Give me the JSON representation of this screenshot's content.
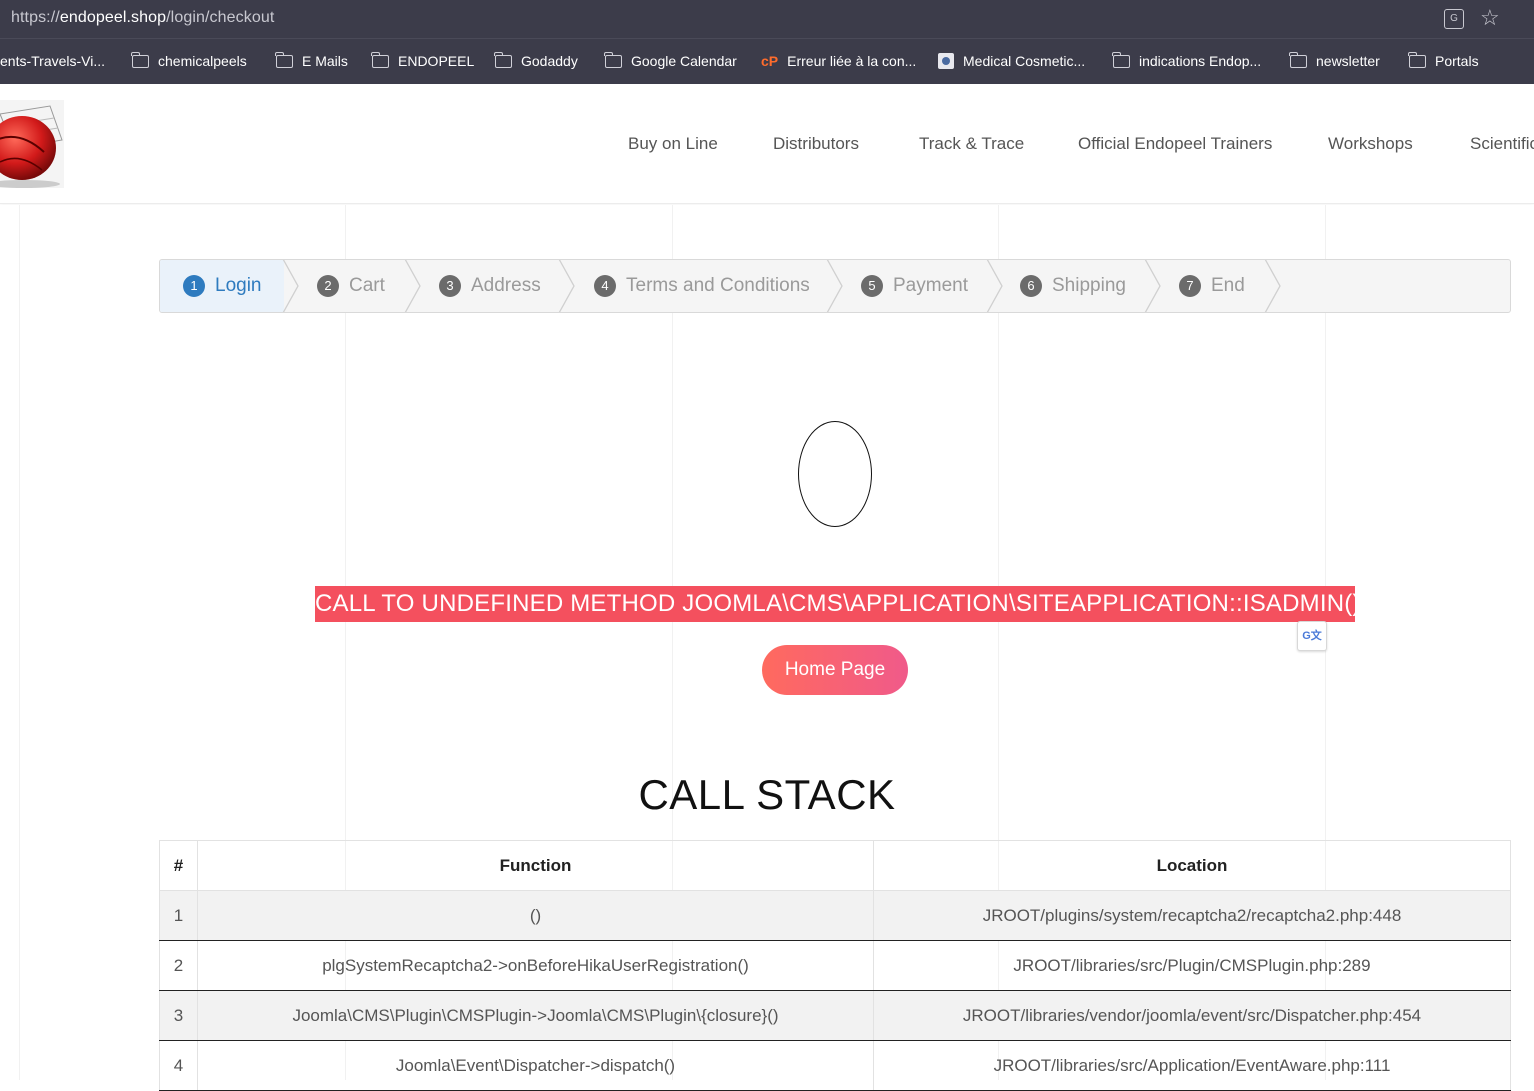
{
  "browser": {
    "url_scheme": "https://",
    "url_host": "endopeel.shop",
    "url_path": "/login/checkout",
    "bookmarks": [
      {
        "label": "ents-Travels-Vi...",
        "icon": "none"
      },
      {
        "label": "chemicalpeels",
        "icon": "folder-icon"
      },
      {
        "label": "E Mails",
        "icon": "folder-icon"
      },
      {
        "label": "ENDOPEEL",
        "icon": "folder-icon"
      },
      {
        "label": "Godaddy",
        "icon": "folder-icon"
      },
      {
        "label": "Google Calendar",
        "icon": "folder-icon"
      },
      {
        "label": "Erreur liée à la con...",
        "icon": "cpanel-icon"
      },
      {
        "label": "Medical Cosmetic...",
        "icon": "site-favicon"
      },
      {
        "label": "indications Endop...",
        "icon": "folder-icon"
      },
      {
        "label": "newsletter",
        "icon": "folder-icon"
      },
      {
        "label": "Portals",
        "icon": "folder-icon"
      }
    ]
  },
  "nav": {
    "items": [
      "Buy on Line",
      "Distributors",
      "Track & Trace",
      "Official Endopeel Trainers",
      "Workshops",
      "Scientific"
    ]
  },
  "steps": [
    {
      "num": "1",
      "label": "Login",
      "active": true
    },
    {
      "num": "2",
      "label": "Cart"
    },
    {
      "num": "3",
      "label": "Address"
    },
    {
      "num": "4",
      "label": "Terms and Conditions"
    },
    {
      "num": "5",
      "label": "Payment"
    },
    {
      "num": "6",
      "label": "Shipping"
    },
    {
      "num": "7",
      "label": "End"
    }
  ],
  "error": {
    "code": "0",
    "message": "CALL TO UNDEFINED METHOD JOOMLA\\CMS\\APPLICATION\\SITEAPPLICATION::ISADMIN()",
    "home_button": "Home Page"
  },
  "call_stack": {
    "title": "CALL STACK",
    "headers": [
      "#",
      "Function",
      "Location"
    ],
    "rows": [
      [
        "1",
        "()",
        "JROOT/plugins/system/recaptcha2/recaptcha2.php:448"
      ],
      [
        "2",
        "plgSystemRecaptcha2->onBeforeHikaUserRegistration()",
        "JROOT/libraries/src/Plugin/CMSPlugin.php:289"
      ],
      [
        "3",
        "Joomla\\CMS\\Plugin\\CMSPlugin->Joomla\\CMS\\Plugin\\{closure}()",
        "JROOT/libraries/vendor/joomla/event/src/Dispatcher.php:454"
      ],
      [
        "4",
        "Joomla\\Event\\Dispatcher->dispatch()",
        "JROOT/libraries/src/Application/EventAware.php:111"
      ]
    ]
  },
  "colors": {
    "error_bg": "#f4505e",
    "active_step": "#2e7bbf"
  }
}
